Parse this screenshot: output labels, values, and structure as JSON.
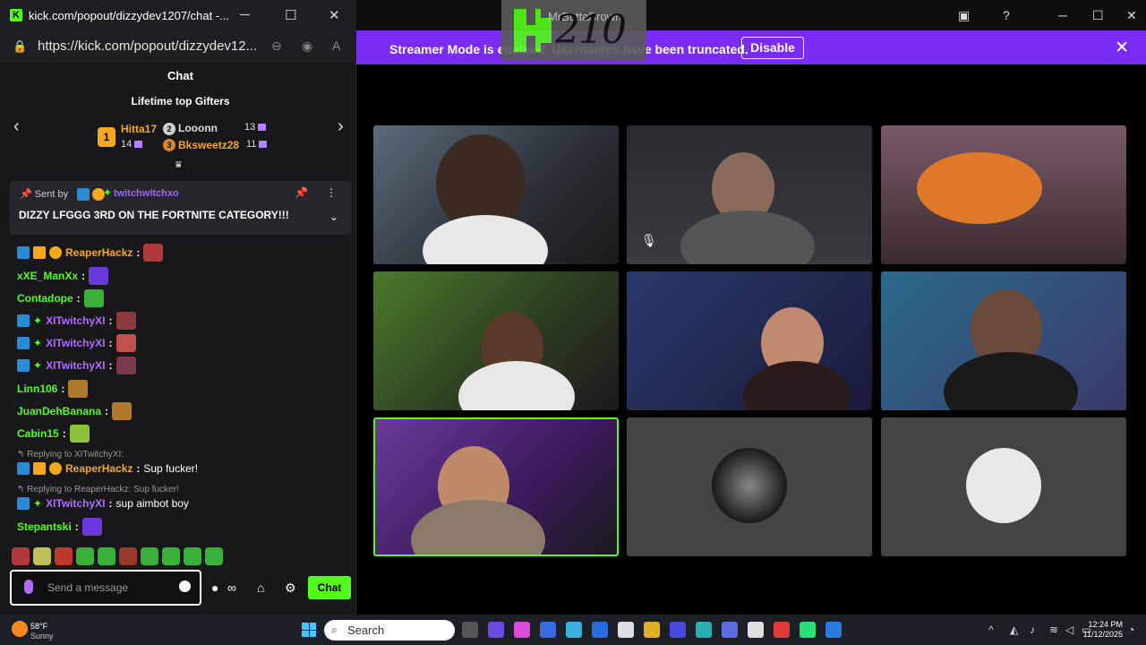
{
  "chat_window": {
    "title": "kick.com/popout/dizzydev1207/chat -...",
    "url": "https://kick.com/popout/dizzydev12...",
    "header": "Chat",
    "gifters_title": "Lifetime top Gifters",
    "gifters": [
      {
        "rank": "1",
        "name": "Hitta17",
        "count": "14",
        "color": "#f4a81f"
      },
      {
        "rank": "2",
        "name": "Looonn",
        "count": "13",
        "color": "#cfcfcf"
      },
      {
        "rank": "3",
        "name": "Bksweetz28",
        "count": "11",
        "color": "#f4a81f"
      }
    ],
    "pinned": {
      "sent_by": "Sent by",
      "sender": "twitchwitchxo",
      "text": "DIZZY LFGGG 3RD ON THE FORTNITE CATEGORY!!!"
    },
    "messages": [
      {
        "user": "ReaperHackz",
        "color": "#f4a81f",
        "text": ""
      },
      {
        "user": "xXE_ManXx",
        "color": "#53fc18",
        "text": ""
      },
      {
        "user": "Contadope",
        "color": "#53fc18",
        "text": ""
      },
      {
        "user": "XITwitchyXI",
        "color": "#b36bff",
        "text": ""
      },
      {
        "user": "XITwitchyXI",
        "color": "#b36bff",
        "text": ""
      },
      {
        "user": "XITwitchyXI",
        "color": "#b36bff",
        "text": ""
      },
      {
        "user": "Linn106",
        "color": "#53fc18",
        "text": ""
      },
      {
        "user": "JuanDehBanana",
        "color": "#53fc18",
        "text": ""
      },
      {
        "user": "Cabin15",
        "color": "#53fc18",
        "text": ""
      },
      {
        "user": "ReaperHackz",
        "color": "#f4a81f",
        "text": "Sup fucker!"
      },
      {
        "user": "XITwitchyXI",
        "color": "#b36bff",
        "text": "sup aimbot boy"
      },
      {
        "user": "Stepantski",
        "color": "#53fc18",
        "text": ""
      }
    ],
    "replies": [
      {
        "text": "Replying to XITwitchyXI:"
      },
      {
        "text": "Replying to ReaperHackz: Sup fucker!"
      }
    ],
    "composer": {
      "placeholder": "Send a message"
    },
    "send_label": "Chat"
  },
  "overlay": {
    "name": "MrButtaBrown",
    "number": "210"
  },
  "banner": {
    "message": "Streamer Mode is enabled. Usernames have been truncated.",
    "disable_label": "Disable"
  },
  "taskbar": {
    "temperature": "58°F",
    "condition": "Sunny",
    "search_label": "Search",
    "time": "12:24 PM",
    "date": "11/12/2025"
  },
  "colors": {
    "kick_green": "#53fc18",
    "banner_purple": "#7a2cf2",
    "chat_bg": "#18181b"
  }
}
